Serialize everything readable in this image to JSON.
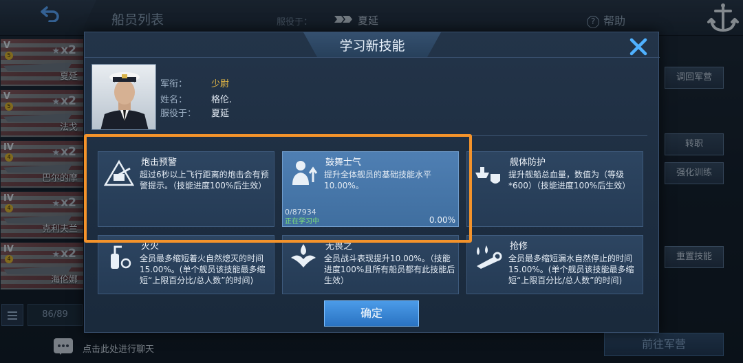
{
  "background": {
    "title": "船员列表",
    "serve_label": "服役于：",
    "serve_ship": "夏延",
    "help": "帮助",
    "ships": [
      {
        "tier": "V",
        "level": "5",
        "mult": "x2",
        "name": "夏延"
      },
      {
        "tier": "V",
        "level": "5",
        "mult": "x2",
        "name": "法戈"
      },
      {
        "tier": "IV",
        "level": "4",
        "mult": "x2",
        "name": "巴尔的摩"
      },
      {
        "tier": "IV",
        "level": "4",
        "mult": "x2",
        "name": "克利夫兰"
      },
      {
        "tier": "IV",
        "level": "4",
        "mult": "x2",
        "name": "海伦娜"
      }
    ],
    "list_count": "86/89",
    "side_buttons": {
      "recall": "调回军营",
      "transfer": "转职",
      "train": "强化训练",
      "reset": "重置技能"
    },
    "barracks_button": "前往军营",
    "chat_hint": "点击此处进行聊天"
  },
  "modal": {
    "title": "学习新技能",
    "officer": {
      "rank_label": "军衔：",
      "rank": "少尉",
      "name_label": "姓名：",
      "name": "格伦.",
      "serve_label": "服役于：",
      "serve": "夏延"
    },
    "skills": [
      {
        "name": "炮击预警",
        "icon": "artillery-warning-icon",
        "desc": "超过6秒以上飞行距离的炮击会有预警提示。（技能进度100%后生效）"
      },
      {
        "name": "鼓舞士气",
        "icon": "morale-icon",
        "desc": "提升全体舰员的基础技能水平10.00%。",
        "progress": "0/87934",
        "status": "正在学习中",
        "percent": "0.00%",
        "progress_fraction": 0
      },
      {
        "name": "舰体防护",
        "icon": "hull-protection-icon",
        "desc": "提升舰船总血量，数值为（等级*600）（技能进度100%后生效）"
      },
      {
        "name": "灭火",
        "icon": "firefighting-icon",
        "desc": "全员最多缩短着火自然熄灭的时间15.00%。(单个舰员该技能最多缩短“上限百分比/总人数”的时间)"
      },
      {
        "name": "无畏之",
        "icon": "fearless-icon",
        "desc": "全员战斗表现提升10.00%。（技能进度100%且所有船员都有此技能后生效）"
      },
      {
        "name": "抢修",
        "icon": "repair-icon",
        "desc": "全员最多缩短漏水自然停止的时间15.00%。(单个舰员该技能最多缩短“上限百分比/总人数”的时间)"
      }
    ],
    "confirm": "确定"
  },
  "colors": {
    "accent_orange": "#f4932b",
    "rank_gold": "#e6b945",
    "learning_green": "#7fe27a",
    "confirm_blue": "#2a73c2"
  }
}
